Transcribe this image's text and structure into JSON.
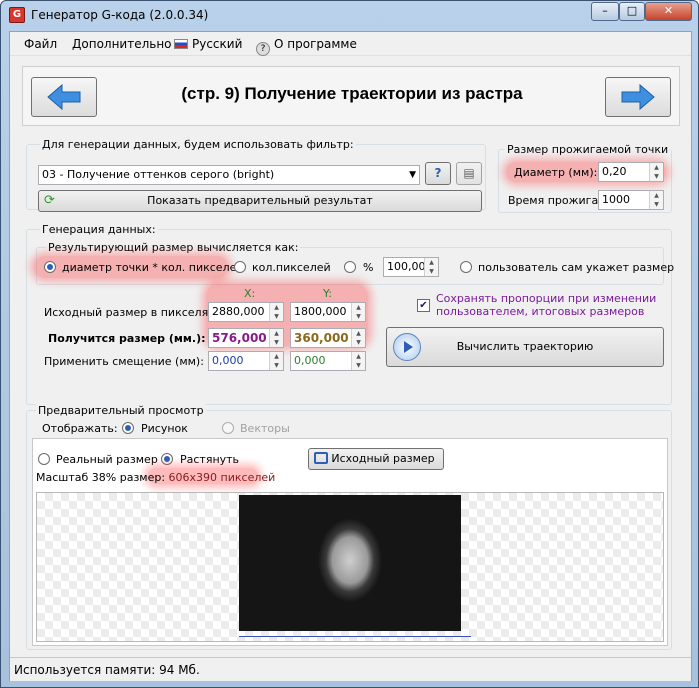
{
  "window": {
    "title": "Генератор G-кода (2.0.0.34)",
    "min_glyph": "–",
    "max_glyph": "□",
    "close_glyph": "✕"
  },
  "menu": {
    "file": "Файл",
    "extra": "Дополнительно",
    "language": "Русский",
    "about": "О программе"
  },
  "header": {
    "title": "(стр. 9) Получение траектории из растра",
    "back_icon": "arrow-left-icon",
    "next_icon": "arrow-right-icon"
  },
  "filter": {
    "label": "Для генерации данных, будем использовать фильтр:",
    "selected": "03 - Получение оттенков серого (bright)",
    "preview_button": "Показать предварительный результат"
  },
  "point": {
    "group_label": "Размер прожигаемой точки",
    "diameter_label": "Диаметр (мм):",
    "diameter_value": "0,20",
    "burn_label": "Время прожига:",
    "burn_value": "1000"
  },
  "generation": {
    "group_label": "Генерация данных:",
    "result_label": "Результирующий размер вычисляется как:",
    "opt1": "диаметр точки * кол. пикселей",
    "opt2": "кол.пикселей",
    "opt3": "%",
    "opt3_value": "100,00",
    "opt4": "пользователь сам укажет размер",
    "x_header": "X:",
    "y_header": "Y:",
    "source_label": "Исходный размер в пикселях:",
    "source_x": "2880,000",
    "source_y": "1800,000",
    "result_size_label": "Получится размер (мм.):",
    "result_x": "576,000",
    "result_y": "360,000",
    "offset_label": "Применить смещение (мм):",
    "offset_x": "0,000",
    "offset_y": "0,000",
    "keep_ratio": "Сохранять пропорции при изменении пользователем, итоговых размеров",
    "compute_button": "Вычислить траекторию"
  },
  "preview": {
    "group_label": "Предварительный просмотр",
    "display_label": "Отображать:",
    "picture": "Рисунок",
    "vectors": "Векторы",
    "real_size": "Реальный размер",
    "stretch": "Растянуть",
    "original_size_button": "Исходный размер",
    "scale_prefix": "Масштаб 38% размер:",
    "scale_value": "606x390 пикселей"
  },
  "status": {
    "memory": "Используется памяти:  94  Мб."
  }
}
